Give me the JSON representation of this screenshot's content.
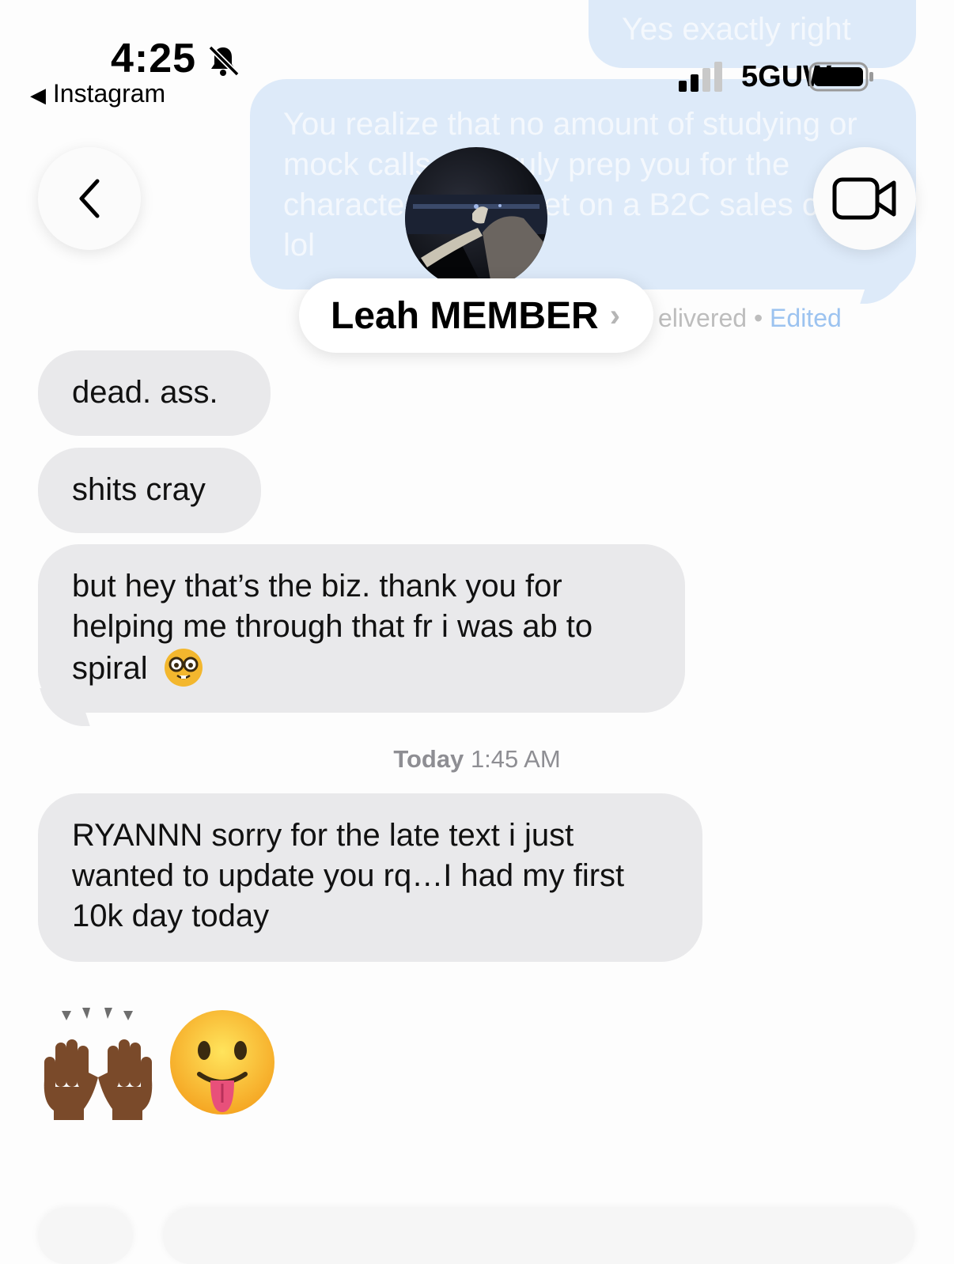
{
  "status_bar": {
    "time": "4:25",
    "back_app": "Instagram",
    "network": "5GUW"
  },
  "header": {
    "contact_name": "Leah MEMBER",
    "chevron": "›",
    "icons": {
      "back": "chevron-left-icon",
      "video": "video-camera-icon",
      "bell": "bell-slash-icon"
    }
  },
  "outgoing": {
    "messages": [
      "Yes exactly right",
      "You realize that no amount of studying or mock calls can truly prep you for the characters you meet on a B2C sales call lol"
    ],
    "delivered": "elivered",
    "edited": "Edited"
  },
  "conversation": {
    "incoming": [
      {
        "text": "dead. ass."
      },
      {
        "text": "shits cray"
      },
      {
        "text": "but hey that’s the biz. thank you for helping me through that fr i was ab to spiral",
        "emoji": "nerd-face-emoji"
      },
      {
        "text": "RYANNN sorry for the late text i just wanted to update you rq…I had my first 10k day today"
      }
    ],
    "timestamp_day": "Today",
    "timestamp_time": "1:45 AM",
    "big_emoji": [
      "raising-hands-emoji",
      "face-with-tongue-emoji"
    ]
  },
  "colors": {
    "incoming_bubble": "#e9e9eb",
    "outgoing_bubble_faded": "#ddeaf9",
    "edited_link": "#9cc3f0"
  }
}
